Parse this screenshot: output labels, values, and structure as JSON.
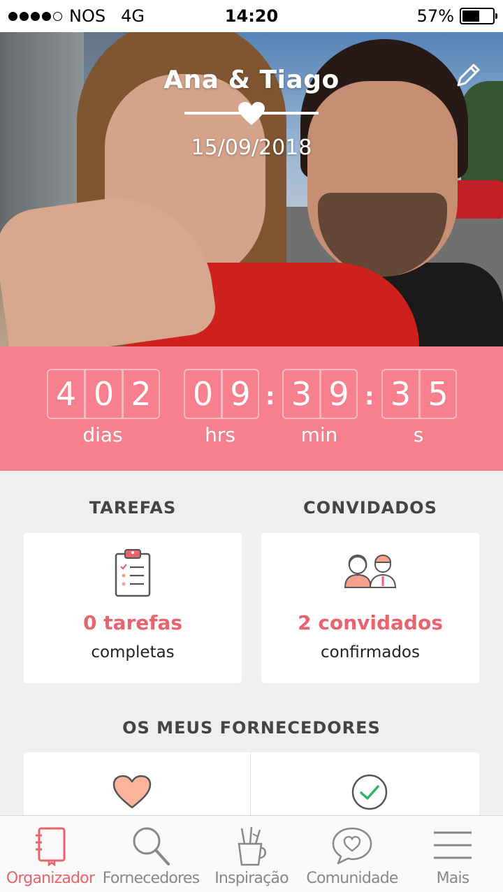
{
  "status_bar": {
    "carrier": "NOS",
    "network": "4G",
    "time": "14:20",
    "battery": "57%",
    "battery_level": 0.57
  },
  "header": {
    "couple_names": "Ana & Tiago",
    "wedding_date": "15/09/2018"
  },
  "countdown": {
    "days": [
      "4",
      "0",
      "2"
    ],
    "hours": [
      "0",
      "9"
    ],
    "minutes": [
      "3",
      "9"
    ],
    "seconds": [
      "3",
      "5"
    ],
    "labels": {
      "days": "dias",
      "hours": "hrs",
      "minutes": "min",
      "seconds": "s"
    }
  },
  "tasks": {
    "title": "TAREFAS",
    "count": "0 tarefas",
    "subtitle": "completas"
  },
  "guests": {
    "title": "CONVIDADOS",
    "count": "2 convidados",
    "subtitle": "confirmados"
  },
  "vendors": {
    "title": "OS MEUS FORNECEDORES"
  },
  "tabs": [
    {
      "label": "Organizador",
      "icon": "notebook-icon"
    },
    {
      "label": "Fornecedores",
      "icon": "search-icon"
    },
    {
      "label": "Inspiração",
      "icon": "pencil-cup-icon"
    },
    {
      "label": "Comunidade",
      "icon": "chat-heart-icon"
    },
    {
      "label": "Mais",
      "icon": "menu-icon"
    }
  ],
  "colors": {
    "accent": "#e8636b",
    "countdown_bg": "#f6808d",
    "background": "#efefef"
  }
}
